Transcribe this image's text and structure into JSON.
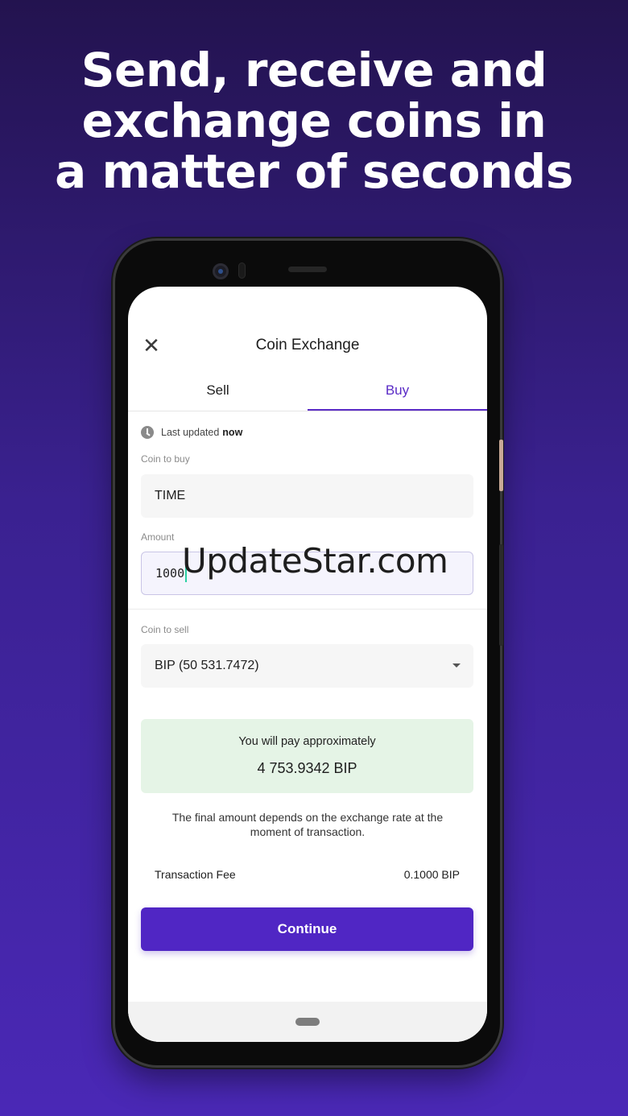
{
  "headline": {
    "line1": "Send, receive and",
    "line2": "exchange coins in",
    "line3": "a matter of seconds"
  },
  "app": {
    "title": "Coin Exchange",
    "close_icon": "close-icon",
    "tabs": [
      {
        "label": "Sell",
        "active": false
      },
      {
        "label": "Buy",
        "active": true
      }
    ],
    "last_updated": {
      "prefix": "Last updated",
      "value": "now",
      "icon": "clock-icon"
    },
    "coin_to_buy": {
      "label": "Coin to buy",
      "value": "TIME"
    },
    "amount": {
      "label": "Amount",
      "value": "1000"
    },
    "coin_to_sell": {
      "label": "Coin to sell",
      "value": "BIP (50 531.7472)",
      "icon": "chevron-down-icon"
    },
    "estimate": {
      "label": "You will pay approximately",
      "value": "4 753.9342 BIP"
    },
    "note": "The final amount depends on the exchange rate at the moment of transaction.",
    "fee": {
      "label": "Transaction Fee",
      "value": "0.1000 BIP"
    },
    "continue_label": "Continue",
    "accent_color": "#5026c4",
    "estimate_bg_color": "#e5f4e6"
  },
  "watermark": "UpdateStar.com"
}
